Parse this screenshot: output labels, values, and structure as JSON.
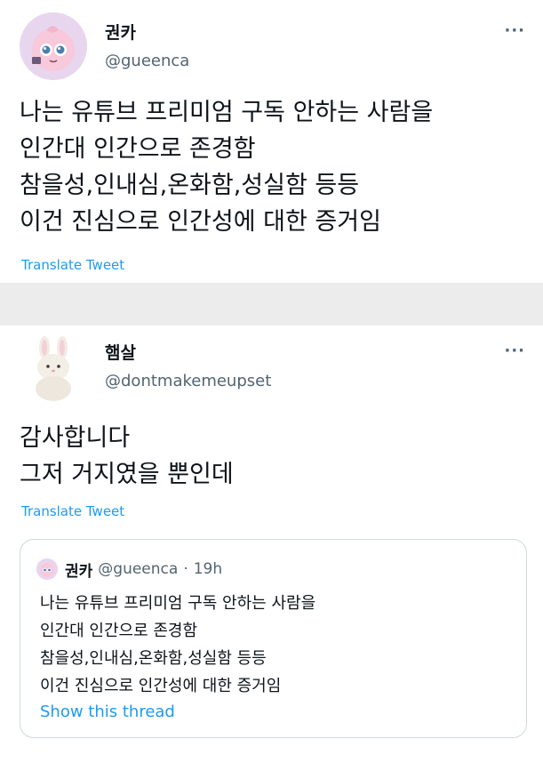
{
  "tweets": [
    {
      "name": "권카",
      "handle": "@gueenca",
      "text": "나는 유튜브 프리미엄 구독 안하는 사람을\n인간대 인간으로 존경함\n참을성,인내심,온화함,성실함 등등\n이건 진심으로 인간성에 대한 증거임",
      "translate_label": "Translate Tweet",
      "more_label": "···"
    },
    {
      "name": "햄살",
      "handle": "@dontmakemeupset",
      "text": "감사합니다\n그저 거지였을 뿐인데",
      "translate_label": "Translate Tweet",
      "more_label": "···",
      "quote": {
        "name": "권카",
        "handle": "@gueenca",
        "separator": "·",
        "time": "19h",
        "text": "나는 유튜브 프리미엄 구독 안하는 사람을\n인간대 인간으로 존경함\n참을성,인내심,온화함,성실함 등등\n이건 진심으로 인간성에 대한 증거임",
        "show_thread_label": "Show this thread"
      }
    }
  ],
  "colors": {
    "link": "#1d9bf0",
    "secondary_text": "#536471",
    "primary_text": "#0f1419",
    "gap_background": "#ececec"
  }
}
